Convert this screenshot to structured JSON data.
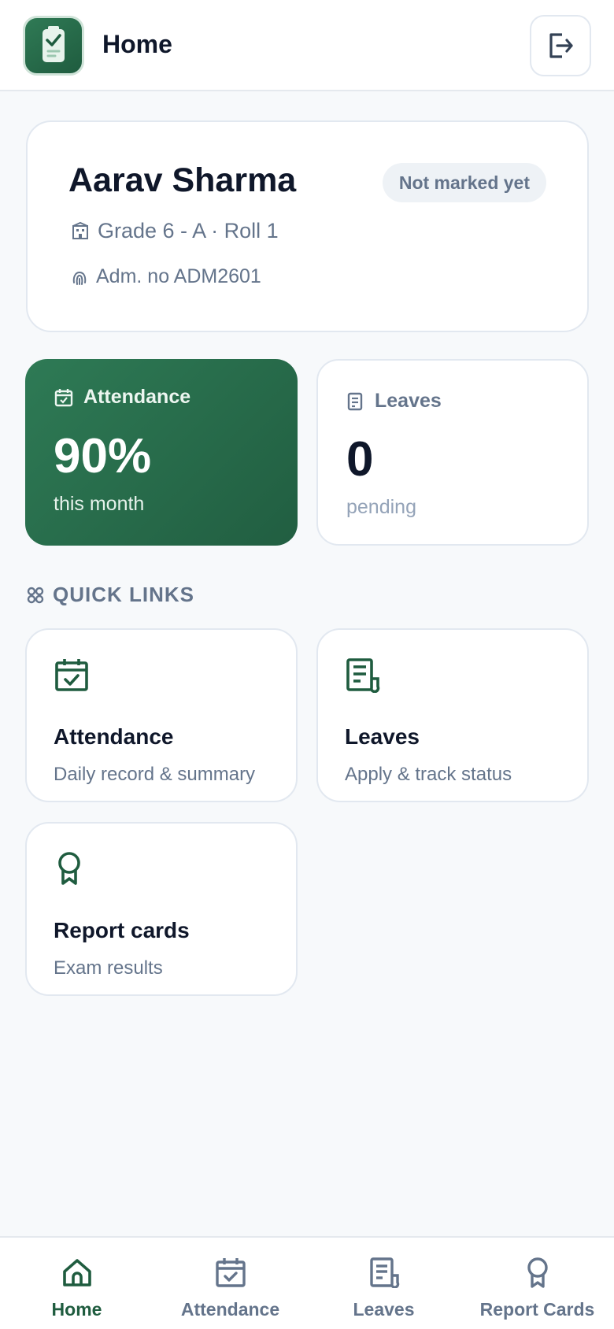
{
  "header": {
    "title": "Home",
    "logo_icon": "clipboard-check-icon",
    "logout_icon": "logout-icon"
  },
  "student": {
    "name": "Aarav Sharma",
    "status": "Not marked yet",
    "class_line": "Grade 6 - A · Roll 1",
    "admission_line": "Adm. no ADM2601"
  },
  "stats": {
    "attendance": {
      "label": "Attendance",
      "value": "90%",
      "sub": "this month"
    },
    "leaves": {
      "label": "Leaves",
      "value": "0",
      "sub": "pending"
    }
  },
  "quick_links": {
    "heading": "QUICK LINKS",
    "items": [
      {
        "title": "Attendance",
        "desc": "Daily record & summary",
        "icon": "calendar-check-icon"
      },
      {
        "title": "Leaves",
        "desc": "Apply & track status",
        "icon": "receipt-icon"
      },
      {
        "title": "Report cards",
        "desc": "Exam results",
        "icon": "award-icon"
      }
    ]
  },
  "nav": {
    "items": [
      {
        "label": "Home",
        "icon": "home-icon",
        "active": true
      },
      {
        "label": "Attendance",
        "icon": "calendar-check-icon",
        "active": false
      },
      {
        "label": "Leaves",
        "icon": "receipt-icon",
        "active": false
      },
      {
        "label": "Report Cards",
        "icon": "award-icon",
        "active": false
      }
    ]
  },
  "colors": {
    "brand": "#1f5c3f",
    "brand_light": "#2e7a55",
    "muted": "#64748b",
    "text": "#0f172a",
    "background": "#f7f9fb"
  }
}
